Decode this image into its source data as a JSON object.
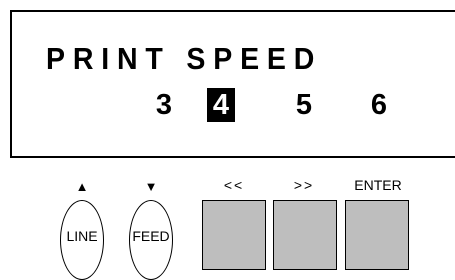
{
  "display": {
    "title": "PRINT SPEED",
    "speeds": [
      "3",
      "4",
      "5",
      "6"
    ],
    "selected": "4"
  },
  "controls": {
    "line": {
      "label": "LINE",
      "hint": "▲"
    },
    "feed": {
      "label": "FEED",
      "hint": "▼"
    },
    "prev": {
      "hint": "<<"
    },
    "next": {
      "hint": ">>"
    },
    "enter": {
      "hint": "ENTER"
    }
  }
}
